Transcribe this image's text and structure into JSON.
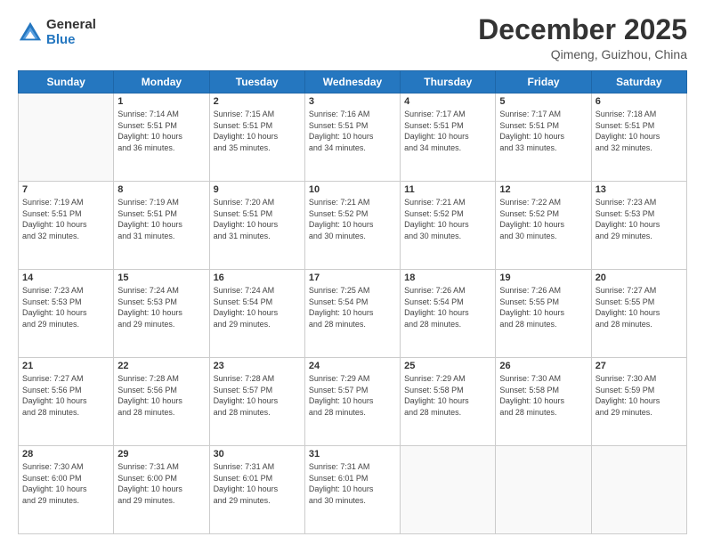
{
  "header": {
    "logo_general": "General",
    "logo_blue": "Blue",
    "month": "December 2025",
    "location": "Qimeng, Guizhou, China"
  },
  "weekdays": [
    "Sunday",
    "Monday",
    "Tuesday",
    "Wednesday",
    "Thursday",
    "Friday",
    "Saturday"
  ],
  "weeks": [
    [
      {
        "day": "",
        "info": ""
      },
      {
        "day": "1",
        "info": "Sunrise: 7:14 AM\nSunset: 5:51 PM\nDaylight: 10 hours\nand 36 minutes."
      },
      {
        "day": "2",
        "info": "Sunrise: 7:15 AM\nSunset: 5:51 PM\nDaylight: 10 hours\nand 35 minutes."
      },
      {
        "day": "3",
        "info": "Sunrise: 7:16 AM\nSunset: 5:51 PM\nDaylight: 10 hours\nand 34 minutes."
      },
      {
        "day": "4",
        "info": "Sunrise: 7:17 AM\nSunset: 5:51 PM\nDaylight: 10 hours\nand 34 minutes."
      },
      {
        "day": "5",
        "info": "Sunrise: 7:17 AM\nSunset: 5:51 PM\nDaylight: 10 hours\nand 33 minutes."
      },
      {
        "day": "6",
        "info": "Sunrise: 7:18 AM\nSunset: 5:51 PM\nDaylight: 10 hours\nand 32 minutes."
      }
    ],
    [
      {
        "day": "7",
        "info": "Sunrise: 7:19 AM\nSunset: 5:51 PM\nDaylight: 10 hours\nand 32 minutes."
      },
      {
        "day": "8",
        "info": "Sunrise: 7:19 AM\nSunset: 5:51 PM\nDaylight: 10 hours\nand 31 minutes."
      },
      {
        "day": "9",
        "info": "Sunrise: 7:20 AM\nSunset: 5:51 PM\nDaylight: 10 hours\nand 31 minutes."
      },
      {
        "day": "10",
        "info": "Sunrise: 7:21 AM\nSunset: 5:52 PM\nDaylight: 10 hours\nand 30 minutes."
      },
      {
        "day": "11",
        "info": "Sunrise: 7:21 AM\nSunset: 5:52 PM\nDaylight: 10 hours\nand 30 minutes."
      },
      {
        "day": "12",
        "info": "Sunrise: 7:22 AM\nSunset: 5:52 PM\nDaylight: 10 hours\nand 30 minutes."
      },
      {
        "day": "13",
        "info": "Sunrise: 7:23 AM\nSunset: 5:53 PM\nDaylight: 10 hours\nand 29 minutes."
      }
    ],
    [
      {
        "day": "14",
        "info": "Sunrise: 7:23 AM\nSunset: 5:53 PM\nDaylight: 10 hours\nand 29 minutes."
      },
      {
        "day": "15",
        "info": "Sunrise: 7:24 AM\nSunset: 5:53 PM\nDaylight: 10 hours\nand 29 minutes."
      },
      {
        "day": "16",
        "info": "Sunrise: 7:24 AM\nSunset: 5:54 PM\nDaylight: 10 hours\nand 29 minutes."
      },
      {
        "day": "17",
        "info": "Sunrise: 7:25 AM\nSunset: 5:54 PM\nDaylight: 10 hours\nand 28 minutes."
      },
      {
        "day": "18",
        "info": "Sunrise: 7:26 AM\nSunset: 5:54 PM\nDaylight: 10 hours\nand 28 minutes."
      },
      {
        "day": "19",
        "info": "Sunrise: 7:26 AM\nSunset: 5:55 PM\nDaylight: 10 hours\nand 28 minutes."
      },
      {
        "day": "20",
        "info": "Sunrise: 7:27 AM\nSunset: 5:55 PM\nDaylight: 10 hours\nand 28 minutes."
      }
    ],
    [
      {
        "day": "21",
        "info": "Sunrise: 7:27 AM\nSunset: 5:56 PM\nDaylight: 10 hours\nand 28 minutes."
      },
      {
        "day": "22",
        "info": "Sunrise: 7:28 AM\nSunset: 5:56 PM\nDaylight: 10 hours\nand 28 minutes."
      },
      {
        "day": "23",
        "info": "Sunrise: 7:28 AM\nSunset: 5:57 PM\nDaylight: 10 hours\nand 28 minutes."
      },
      {
        "day": "24",
        "info": "Sunrise: 7:29 AM\nSunset: 5:57 PM\nDaylight: 10 hours\nand 28 minutes."
      },
      {
        "day": "25",
        "info": "Sunrise: 7:29 AM\nSunset: 5:58 PM\nDaylight: 10 hours\nand 28 minutes."
      },
      {
        "day": "26",
        "info": "Sunrise: 7:30 AM\nSunset: 5:58 PM\nDaylight: 10 hours\nand 28 minutes."
      },
      {
        "day": "27",
        "info": "Sunrise: 7:30 AM\nSunset: 5:59 PM\nDaylight: 10 hours\nand 29 minutes."
      }
    ],
    [
      {
        "day": "28",
        "info": "Sunrise: 7:30 AM\nSunset: 6:00 PM\nDaylight: 10 hours\nand 29 minutes."
      },
      {
        "day": "29",
        "info": "Sunrise: 7:31 AM\nSunset: 6:00 PM\nDaylight: 10 hours\nand 29 minutes."
      },
      {
        "day": "30",
        "info": "Sunrise: 7:31 AM\nSunset: 6:01 PM\nDaylight: 10 hours\nand 29 minutes."
      },
      {
        "day": "31",
        "info": "Sunrise: 7:31 AM\nSunset: 6:01 PM\nDaylight: 10 hours\nand 30 minutes."
      },
      {
        "day": "",
        "info": ""
      },
      {
        "day": "",
        "info": ""
      },
      {
        "day": "",
        "info": ""
      }
    ]
  ]
}
